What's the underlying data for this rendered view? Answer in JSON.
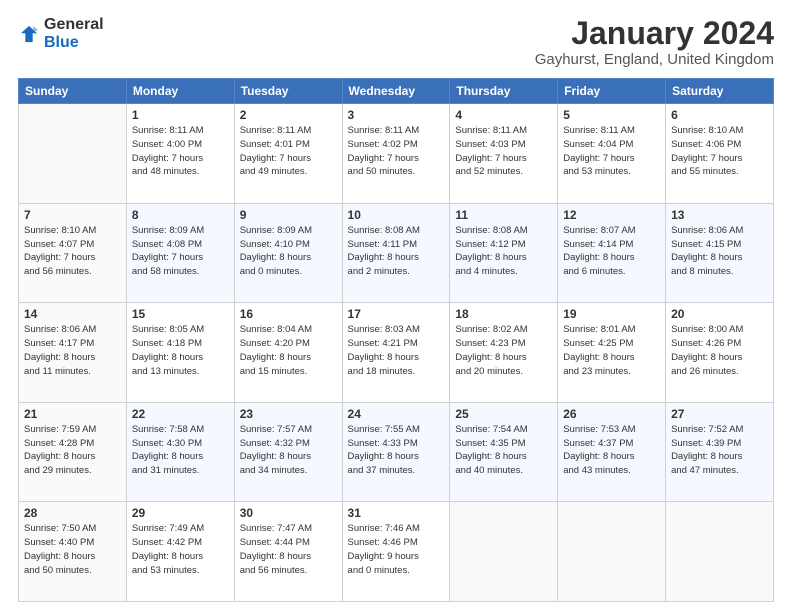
{
  "logo": {
    "general": "General",
    "blue": "Blue"
  },
  "header": {
    "month": "January 2024",
    "location": "Gayhurst, England, United Kingdom"
  },
  "weekdays": [
    "Sunday",
    "Monday",
    "Tuesday",
    "Wednesday",
    "Thursday",
    "Friday",
    "Saturday"
  ],
  "weeks": [
    [
      {
        "day": "",
        "info": ""
      },
      {
        "day": "1",
        "info": "Sunrise: 8:11 AM\nSunset: 4:00 PM\nDaylight: 7 hours\nand 48 minutes."
      },
      {
        "day": "2",
        "info": "Sunrise: 8:11 AM\nSunset: 4:01 PM\nDaylight: 7 hours\nand 49 minutes."
      },
      {
        "day": "3",
        "info": "Sunrise: 8:11 AM\nSunset: 4:02 PM\nDaylight: 7 hours\nand 50 minutes."
      },
      {
        "day": "4",
        "info": "Sunrise: 8:11 AM\nSunset: 4:03 PM\nDaylight: 7 hours\nand 52 minutes."
      },
      {
        "day": "5",
        "info": "Sunrise: 8:11 AM\nSunset: 4:04 PM\nDaylight: 7 hours\nand 53 minutes."
      },
      {
        "day": "6",
        "info": "Sunrise: 8:10 AM\nSunset: 4:06 PM\nDaylight: 7 hours\nand 55 minutes."
      }
    ],
    [
      {
        "day": "7",
        "info": "Sunrise: 8:10 AM\nSunset: 4:07 PM\nDaylight: 7 hours\nand 56 minutes."
      },
      {
        "day": "8",
        "info": "Sunrise: 8:09 AM\nSunset: 4:08 PM\nDaylight: 7 hours\nand 58 minutes."
      },
      {
        "day": "9",
        "info": "Sunrise: 8:09 AM\nSunset: 4:10 PM\nDaylight: 8 hours\nand 0 minutes."
      },
      {
        "day": "10",
        "info": "Sunrise: 8:08 AM\nSunset: 4:11 PM\nDaylight: 8 hours\nand 2 minutes."
      },
      {
        "day": "11",
        "info": "Sunrise: 8:08 AM\nSunset: 4:12 PM\nDaylight: 8 hours\nand 4 minutes."
      },
      {
        "day": "12",
        "info": "Sunrise: 8:07 AM\nSunset: 4:14 PM\nDaylight: 8 hours\nand 6 minutes."
      },
      {
        "day": "13",
        "info": "Sunrise: 8:06 AM\nSunset: 4:15 PM\nDaylight: 8 hours\nand 8 minutes."
      }
    ],
    [
      {
        "day": "14",
        "info": "Sunrise: 8:06 AM\nSunset: 4:17 PM\nDaylight: 8 hours\nand 11 minutes."
      },
      {
        "day": "15",
        "info": "Sunrise: 8:05 AM\nSunset: 4:18 PM\nDaylight: 8 hours\nand 13 minutes."
      },
      {
        "day": "16",
        "info": "Sunrise: 8:04 AM\nSunset: 4:20 PM\nDaylight: 8 hours\nand 15 minutes."
      },
      {
        "day": "17",
        "info": "Sunrise: 8:03 AM\nSunset: 4:21 PM\nDaylight: 8 hours\nand 18 minutes."
      },
      {
        "day": "18",
        "info": "Sunrise: 8:02 AM\nSunset: 4:23 PM\nDaylight: 8 hours\nand 20 minutes."
      },
      {
        "day": "19",
        "info": "Sunrise: 8:01 AM\nSunset: 4:25 PM\nDaylight: 8 hours\nand 23 minutes."
      },
      {
        "day": "20",
        "info": "Sunrise: 8:00 AM\nSunset: 4:26 PM\nDaylight: 8 hours\nand 26 minutes."
      }
    ],
    [
      {
        "day": "21",
        "info": "Sunrise: 7:59 AM\nSunset: 4:28 PM\nDaylight: 8 hours\nand 29 minutes."
      },
      {
        "day": "22",
        "info": "Sunrise: 7:58 AM\nSunset: 4:30 PM\nDaylight: 8 hours\nand 31 minutes."
      },
      {
        "day": "23",
        "info": "Sunrise: 7:57 AM\nSunset: 4:32 PM\nDaylight: 8 hours\nand 34 minutes."
      },
      {
        "day": "24",
        "info": "Sunrise: 7:55 AM\nSunset: 4:33 PM\nDaylight: 8 hours\nand 37 minutes."
      },
      {
        "day": "25",
        "info": "Sunrise: 7:54 AM\nSunset: 4:35 PM\nDaylight: 8 hours\nand 40 minutes."
      },
      {
        "day": "26",
        "info": "Sunrise: 7:53 AM\nSunset: 4:37 PM\nDaylight: 8 hours\nand 43 minutes."
      },
      {
        "day": "27",
        "info": "Sunrise: 7:52 AM\nSunset: 4:39 PM\nDaylight: 8 hours\nand 47 minutes."
      }
    ],
    [
      {
        "day": "28",
        "info": "Sunrise: 7:50 AM\nSunset: 4:40 PM\nDaylight: 8 hours\nand 50 minutes."
      },
      {
        "day": "29",
        "info": "Sunrise: 7:49 AM\nSunset: 4:42 PM\nDaylight: 8 hours\nand 53 minutes."
      },
      {
        "day": "30",
        "info": "Sunrise: 7:47 AM\nSunset: 4:44 PM\nDaylight: 8 hours\nand 56 minutes."
      },
      {
        "day": "31",
        "info": "Sunrise: 7:46 AM\nSunset: 4:46 PM\nDaylight: 9 hours\nand 0 minutes."
      },
      {
        "day": "",
        "info": ""
      },
      {
        "day": "",
        "info": ""
      },
      {
        "day": "",
        "info": ""
      }
    ]
  ]
}
